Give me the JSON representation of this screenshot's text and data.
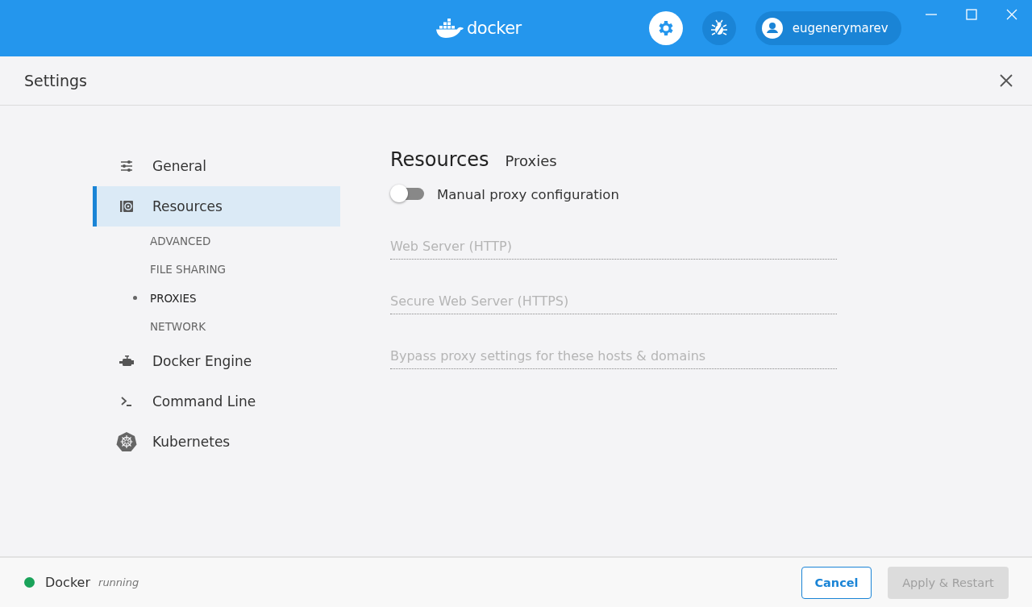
{
  "topbar": {
    "logo_text": "docker",
    "user": "eugenerymarev"
  },
  "header": {
    "title": "Settings"
  },
  "sidebar": {
    "items": [
      {
        "label": "General",
        "kind": "general",
        "selected": false
      },
      {
        "label": "Resources",
        "kind": "resources",
        "selected": true,
        "children": [
          {
            "label": "ADVANCED",
            "selected": false
          },
          {
            "label": "FILE SHARING",
            "selected": false
          },
          {
            "label": "PROXIES",
            "selected": true
          },
          {
            "label": "NETWORK",
            "selected": false
          }
        ]
      },
      {
        "label": "Docker Engine",
        "kind": "engine",
        "selected": false
      },
      {
        "label": "Command Line",
        "kind": "cli",
        "selected": false
      },
      {
        "label": "Kubernetes",
        "kind": "kubernetes",
        "selected": false
      }
    ]
  },
  "content": {
    "title": "Resources",
    "subtitle": "Proxies",
    "toggle": {
      "label": "Manual proxy configuration",
      "on": false
    },
    "fields": [
      {
        "placeholder": "Web Server (HTTP)"
      },
      {
        "placeholder": "Secure Web Server (HTTPS)"
      },
      {
        "placeholder": "Bypass proxy settings for these hosts & domains"
      }
    ]
  },
  "footer": {
    "status": {
      "name": "Docker",
      "state": "running",
      "color": "#1aa35a"
    },
    "buttons": [
      {
        "label": "Cancel",
        "kind": "secondary",
        "disabled": false
      },
      {
        "label": "Apply & Restart",
        "kind": "primary",
        "disabled": true
      }
    ]
  }
}
